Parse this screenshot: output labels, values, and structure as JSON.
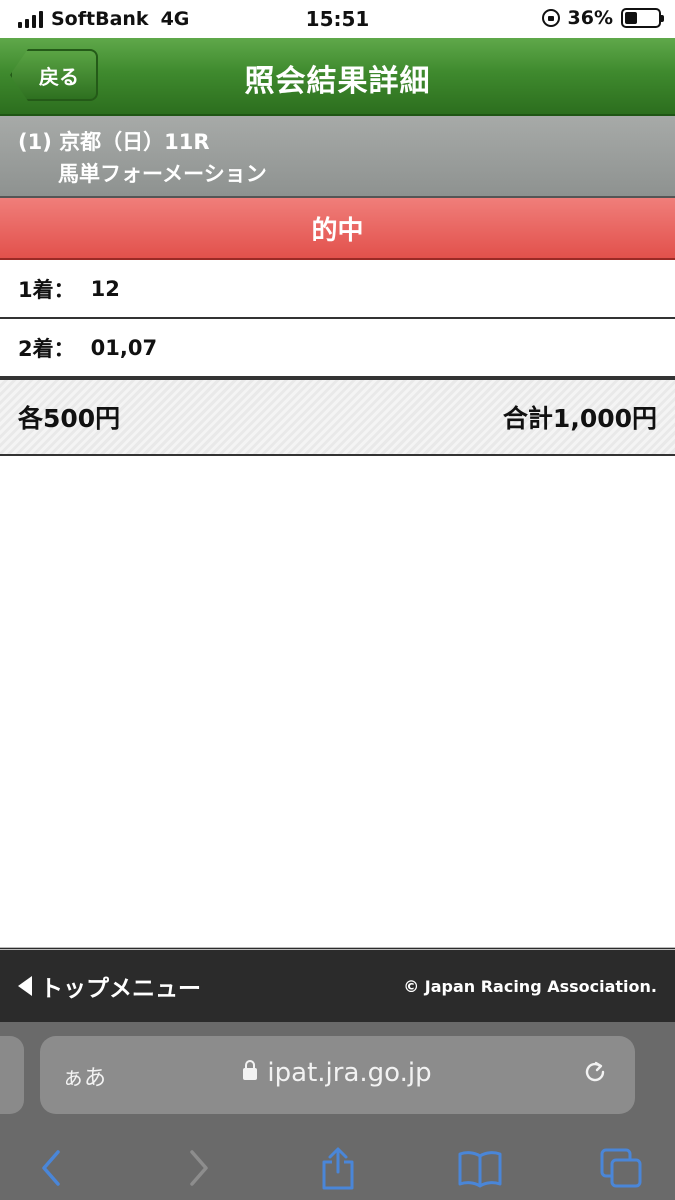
{
  "status": {
    "carrier": "SoftBank",
    "network": "4G",
    "time": "15:51",
    "battery_text": "36%",
    "battery_level": 0.36
  },
  "header": {
    "back_label": "戻る",
    "title": "照会結果詳細"
  },
  "race": {
    "line1": "(1) 京都（日）11R",
    "line2": "馬単フォーメーション"
  },
  "result": {
    "banner": "的中",
    "rows": [
      {
        "label": "1着：",
        "value": "12"
      },
      {
        "label": "2着：",
        "value": "01,07"
      }
    ],
    "each": "各500円",
    "total": "合計1,000円"
  },
  "footer": {
    "top_menu": "トップメニュー",
    "copyright": "© Japan Racing Association."
  },
  "browser": {
    "aa": "ぁあ",
    "url": "ipat.jra.go.jp"
  },
  "colors": {
    "header_green": "#3f8a2e",
    "hit_red": "#e2514c",
    "race_gray": "#9a9d9b",
    "safari_blue": "#4a86d8"
  }
}
